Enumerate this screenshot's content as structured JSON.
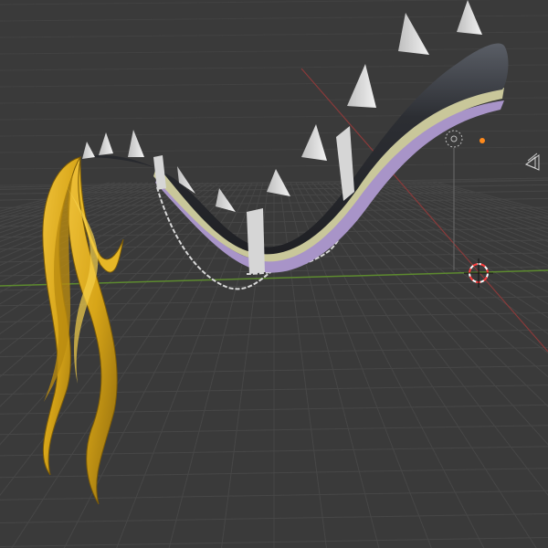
{
  "viewport": {
    "background": "#3a3a3a",
    "grid_color": "#474747",
    "x_axis_color": "#8a3a3a",
    "y_axis_color": "#5d8a2f"
  },
  "model": {
    "tail_body_dark": "#2c2e33",
    "tail_body_light": "#5a5e66",
    "stripe_cream": "#c9c79a",
    "stripe_lavender": "#a894c8",
    "spike_color": "#d9d9d9",
    "band_color": "#d6d6d6",
    "chain_color": "#d8d8d8",
    "tuft_color": "#d7a518",
    "tuft_dark": "#7a5a08"
  },
  "overlay": {
    "light_icon": "light-icon",
    "camera_icon": "camera-icon",
    "cursor_icon": "3d-cursor-icon",
    "origin_color": "#ff8a1c",
    "cursor_red": "#ff3c3c"
  }
}
